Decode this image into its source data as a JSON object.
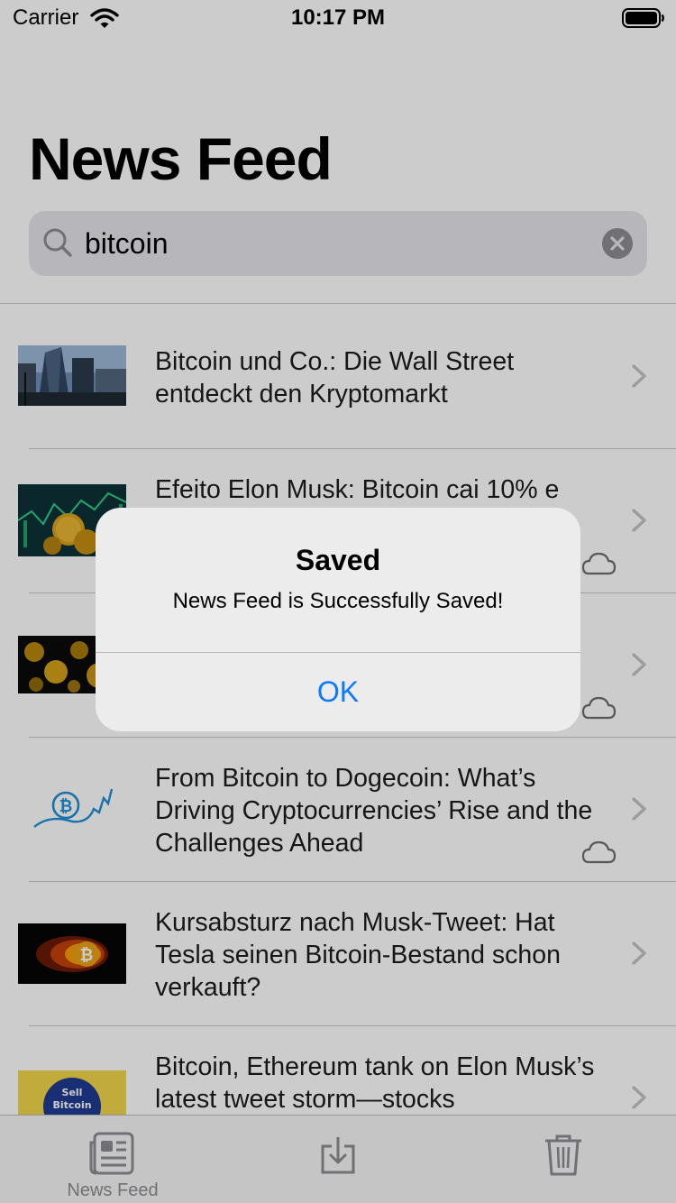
{
  "status_bar": {
    "carrier": "Carrier",
    "time": "10:17 PM",
    "wifi_icon": "wifi-icon",
    "battery_icon": "battery-icon"
  },
  "header": {
    "title": "News Feed"
  },
  "search": {
    "value": "bitcoin",
    "icon": "search-icon",
    "clear_icon": "clear-icon"
  },
  "news": {
    "items": [
      {
        "title": "Bitcoin und Co.: Die Wall Street entdeckt den Kryptomarkt",
        "saved": false
      },
      {
        "title": "Efeito Elon Musk: Bitcoin cai 10% e",
        "saved": true
      },
      {
        "title": "",
        "saved": true
      },
      {
        "title": "From Bitcoin to Dogecoin: What’s Driving Cryptocurrencies’ Rise and the Challenges Ahead",
        "saved": true
      },
      {
        "title": "Kursabsturz nach Musk-Tweet: Hat Tesla seinen Bitcoin-Bestand schon verkauft?",
        "saved": false
      },
      {
        "title": "Bitcoin, Ethereum tank on Elon Musk’s latest tweet storm—stocks",
        "saved": false
      }
    ]
  },
  "tab_bar": {
    "tabs": [
      {
        "label": "News Feed",
        "icon": "newspaper-icon",
        "selected": true
      },
      {
        "label": "",
        "icon": "download-icon",
        "selected": false
      },
      {
        "label": "",
        "icon": "trash-icon",
        "selected": false
      }
    ]
  },
  "alert": {
    "title": "Saved",
    "message": "News Feed is Successfully Saved!",
    "button": "OK"
  },
  "colors": {
    "accent": "#0a7aff",
    "tab_inactive": "#8e8e93",
    "overlay": "rgba(0,0,0,0.2)"
  }
}
